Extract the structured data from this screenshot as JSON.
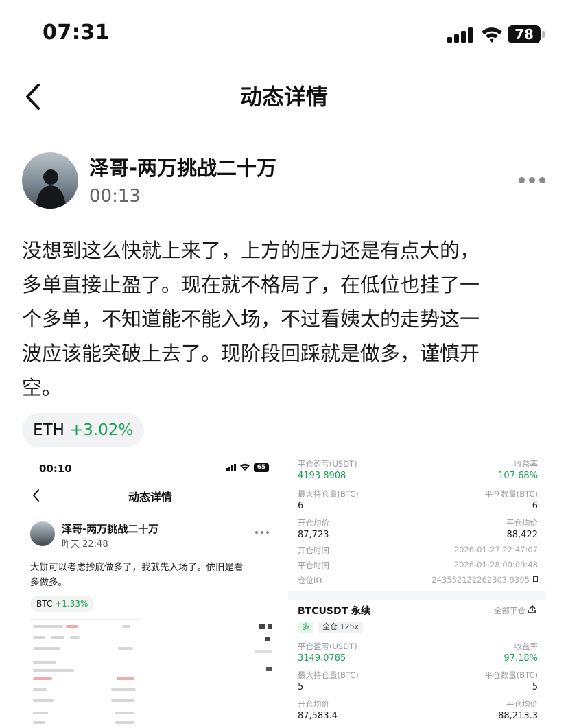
{
  "status_bar": {
    "time": "07:31",
    "battery": "78"
  },
  "nav": {
    "title": "动态详情"
  },
  "post": {
    "username": "泽哥-两万挑战二十万",
    "time": "00:13",
    "content_lines": [
      "没想到这么快就上来了，上方的压力还是有点大的，",
      "多单直接止盈了。现在就不格局了，在低位也挂了一",
      "个多单，不知道能不能入场，不过看姨太的走势这一",
      "波应该能突破上去了。现阶段回踩就是做多，谨慎开",
      "空。"
    ],
    "tag": {
      "symbol": "ETH",
      "change": "+3.02%"
    }
  },
  "embedded_left": {
    "status_time": "00:10",
    "battery": "65",
    "title": "动态详情",
    "username": "泽哥-两万挑战二十万",
    "time": "昨天 22:48",
    "content_lines": [
      "大饼可以考虑抄底做多了，我就先入场了。依旧是看",
      "多做多。"
    ],
    "tag": {
      "symbol": "BTC",
      "change": "+1.33%"
    }
  },
  "embedded_right": {
    "top_rows": [
      {
        "left_label": "平仓盈亏(USDT)",
        "left_value": "4193.8908",
        "right_label": "收益率",
        "right_value": "107.68%",
        "green": true
      },
      {
        "left_label": "最大持仓量(BTC)",
        "left_value": "6",
        "right_label": "平仓数量(BTC)",
        "right_value": "6",
        "green": false
      },
      {
        "left_label": "开仓均价",
        "left_value": "87,723",
        "right_label": "平仓均价",
        "right_value": "88,422",
        "green": false
      }
    ],
    "time_rows": [
      {
        "label": "开仓时间",
        "value": "2026-01-27 22:47:07"
      },
      {
        "label": "平仓时间",
        "value": "2026-01-28 00:09:48"
      },
      {
        "label": "仓位ID",
        "value": "243552122262303 9395"
      }
    ],
    "pair": "BTCUSDT 永续",
    "close_all": "全部平仓",
    "badge_side": "多",
    "badge_mode": "全仓 125x",
    "bottom_rows": [
      {
        "left_label": "平仓盈亏(USDT)",
        "left_value": "3149.0785",
        "right_label": "收益率",
        "right_value": "97.18%",
        "green": true
      },
      {
        "left_label": "最大持仓量(BTC)",
        "left_value": "5",
        "right_label": "平仓数量(BTC)",
        "right_value": "5",
        "green": false
      },
      {
        "left_label": "开仓均价",
        "left_value": "87,583.4",
        "right_label": "平仓均价",
        "right_value": "88,213.3",
        "green": false
      }
    ]
  },
  "colors": {
    "green": "#1aa154",
    "text": "#111111",
    "muted": "#666666",
    "tag_bg": "#f1f3f5"
  },
  "icons": [
    "signal-icon",
    "wifi-icon",
    "battery-icon",
    "back-arrow-icon",
    "more-icon",
    "copy-icon",
    "share-icon"
  ]
}
